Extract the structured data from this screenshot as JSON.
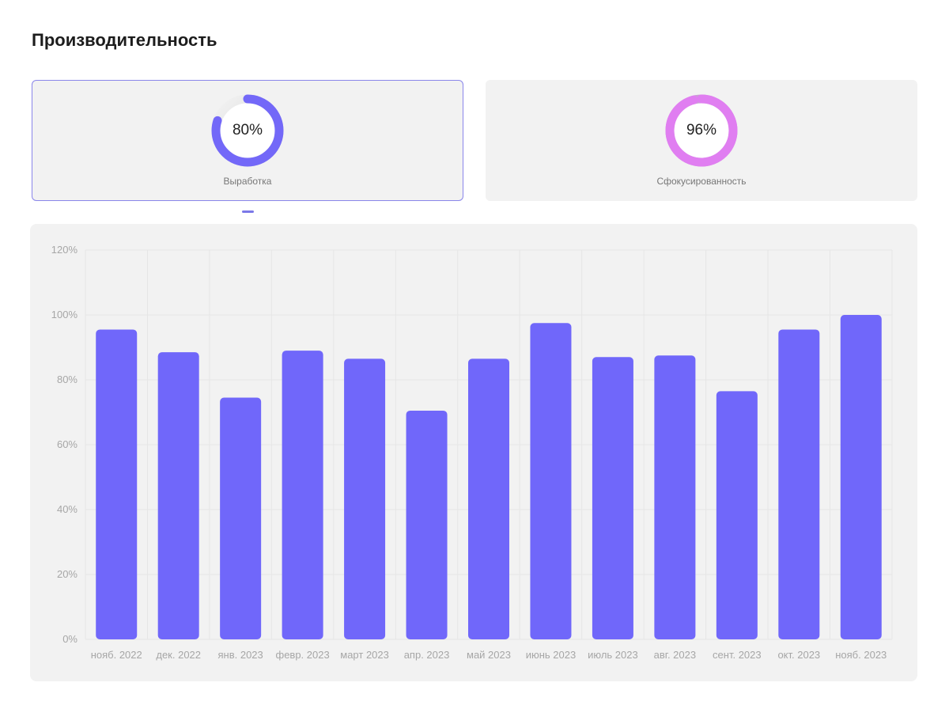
{
  "page_title": "Производительность",
  "cards": [
    {
      "value_label": "80%",
      "value": 80,
      "label": "Выработка",
      "color": "#7368f8",
      "track_color": "#e0e0e0",
      "selected": true
    },
    {
      "value_label": "96%",
      "value": 96,
      "label": "Сфокусированность",
      "color": "#e07ef1",
      "track_color": "#c9a0d4",
      "selected": false
    }
  ],
  "colors": {
    "bar": "#7067fa",
    "accent_border": "#8a86ea",
    "panel_background": "#f2f2f2"
  },
  "chart_data": {
    "type": "bar",
    "categories": [
      "нояб. 2022",
      "дек. 2022",
      "янв. 2023",
      "февр. 2023",
      "март 2023",
      "апр. 2023",
      "май 2023",
      "июнь 2023",
      "июль 2023",
      "авг. 2023",
      "сент. 2023",
      "окт. 2023",
      "нояб. 2023"
    ],
    "values": [
      95.5,
      88.5,
      74.5,
      89,
      86.5,
      70.5,
      86.5,
      97.5,
      87,
      87.5,
      76.5,
      95.5,
      100
    ],
    "yticks": [
      "0%",
      "20%",
      "40%",
      "60%",
      "80%",
      "100%",
      "120%"
    ],
    "ylim": [
      0,
      120
    ],
    "grid": true
  }
}
